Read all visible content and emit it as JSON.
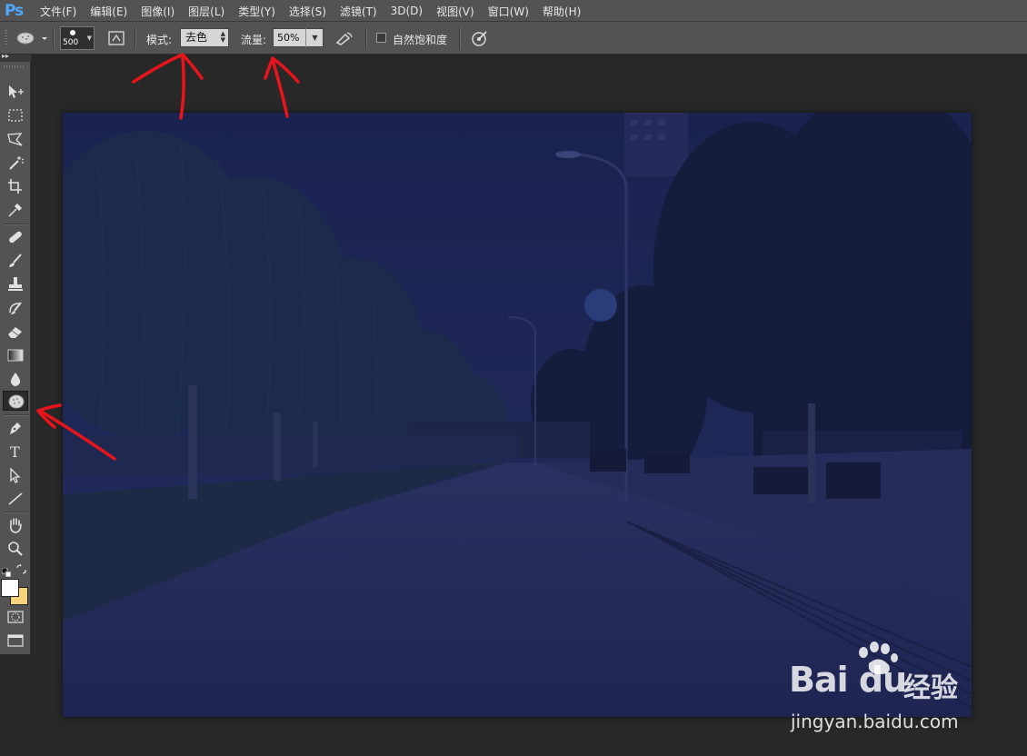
{
  "app": {
    "logo": "Ps"
  },
  "menu": {
    "items": [
      "文件(F)",
      "编辑(E)",
      "图像(I)",
      "图层(L)",
      "类型(Y)",
      "选择(S)",
      "滤镜(T)",
      "3D(D)",
      "视图(V)",
      "窗口(W)",
      "帮助(H)"
    ]
  },
  "options": {
    "brush_size": "500",
    "mode_label": "模式:",
    "mode_value": "去色",
    "flow_label": "流量:",
    "flow_value": "50%",
    "vibrance_label": "自然饱和度",
    "vibrance_checked": false
  },
  "tools": {
    "active": "sponge-tool",
    "list": [
      "move-tool",
      "marquee-tool",
      "lasso-tool",
      "magic-wand-tool",
      "crop-tool",
      "eyedropper-tool",
      "healing-brush-tool",
      "brush-tool",
      "clone-stamp-tool",
      "history-brush-tool",
      "eraser-tool",
      "gradient-tool",
      "blur-tool",
      "sponge-tool",
      "pen-tool",
      "type-tool",
      "path-selection-tool",
      "line-tool",
      "hand-tool",
      "zoom-tool"
    ]
  },
  "colors": {
    "foreground": "#ffffff",
    "background": "#f5d37a",
    "accent_annotation": "#e8141b"
  },
  "watermark": {
    "brand": "Bai du",
    "cn": "经验",
    "url": "jingyan.baidu.com"
  }
}
